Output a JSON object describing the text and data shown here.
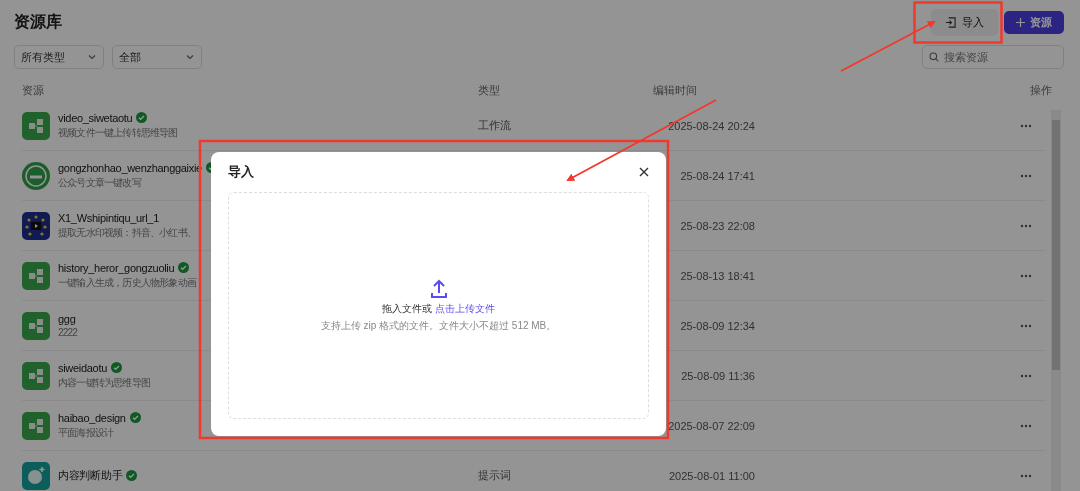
{
  "page": {
    "title": "资源库"
  },
  "filters": [
    {
      "value": "所有类型"
    },
    {
      "value": "全部"
    }
  ],
  "toolbar": {
    "import_button": "导入",
    "add_button": "资源",
    "search": {
      "placeholder": "搜索资源"
    }
  },
  "table": {
    "columns": [
      "资源",
      "类型",
      "编辑时间",
      "操作"
    ],
    "rows": [
      {
        "kind": "workflow",
        "name": "video_siwetaotu",
        "verified": true,
        "description": "视频文件一键上传转思维导图",
        "type": "工作流",
        "edited": "2025-08-24 20:24"
      },
      {
        "kind": "circle",
        "name": "gongzhonhao_wenzhanggaixie",
        "verified": true,
        "description": "公众号文章一键改写",
        "edited": "25-08-24 17:41"
      },
      {
        "kind": "dots",
        "name": "X1_Wshipintiqu_url_1",
        "verified": false,
        "description": "提取无水印视频：抖音、小红书、",
        "edited": "25-08-23 22:08"
      },
      {
        "kind": "workflow",
        "name": "history_heror_gongzuoliu",
        "verified": true,
        "description": "一键输入生成，历史人物形象动画",
        "edited": "25-08-13 18:41"
      },
      {
        "kind": "workflow",
        "name": "ggg",
        "verified": false,
        "description": "2222",
        "edited": "25-08-09 12:34"
      },
      {
        "kind": "workflow",
        "name": "siweidaotu",
        "verified": true,
        "description": "内容一键转为思维导图",
        "edited": "25-08-09 11:36"
      },
      {
        "kind": "workflow",
        "name": "haibao_design",
        "verified": true,
        "description": "平面海报设计",
        "edited": "2025-08-07 22:09"
      },
      {
        "kind": "round",
        "name": "内容判断助手",
        "verified": true,
        "type": "提示词",
        "edited": "2025-08-01 11:00"
      }
    ]
  },
  "dialog": {
    "title": "导入",
    "prompt": "拖入文件或",
    "link": "点击上传文件",
    "hint": "支持上传 zip 格式的文件。文件大小不超过 512 MB。"
  }
}
